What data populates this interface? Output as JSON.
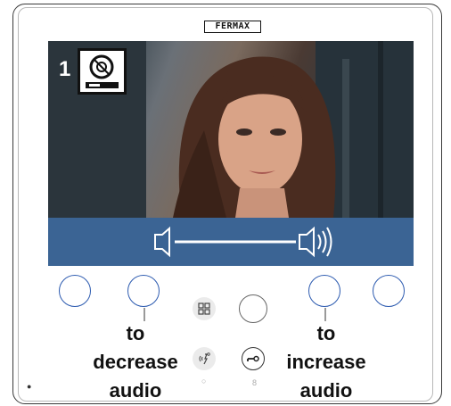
{
  "device": {
    "brand": "FERMAX",
    "camera_number": "1",
    "camera_icon": "camera-station-icon",
    "audio_bar": {
      "decrease_icon": "speaker-low-icon",
      "increase_icon": "speaker-high-icon",
      "level": 0.5
    },
    "buttons": {
      "menu_icon": "menu-grid-icon",
      "autoon_icon": "auto-on-icon",
      "door_icon": "door-key-icon"
    }
  },
  "annotations": {
    "left": {
      "line1": "to",
      "line2": "decrease",
      "line3": "audio"
    },
    "right": {
      "line1": "to",
      "line2": "increase",
      "line3": "audio"
    }
  },
  "colors": {
    "audio_bar": "#3b6494",
    "soft_button_ring": "#2d5bb0"
  }
}
